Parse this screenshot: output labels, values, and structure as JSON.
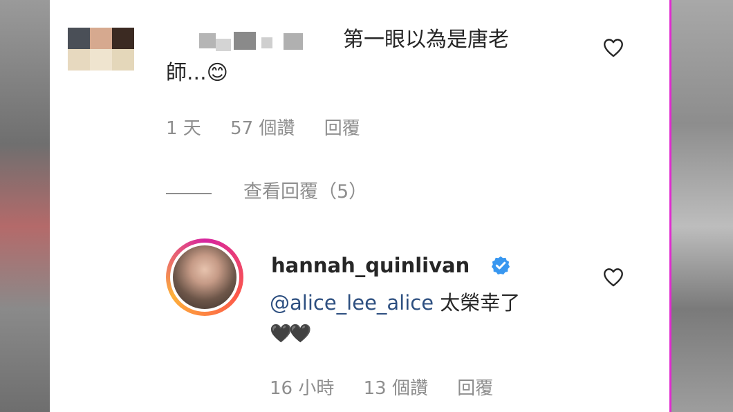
{
  "comment1": {
    "text_line1": "第一眼以為是唐老",
    "text_line2": "師...😊",
    "time": "1 天",
    "likes": "57 個讚",
    "reply": "回覆",
    "view_replies": "查看回覆（5）"
  },
  "comment2": {
    "username": "hannah_quinlivan",
    "mention": "@alice_lee_alice",
    "text": " 太榮幸了",
    "emoji": "🖤🖤",
    "time": "16 小時",
    "likes": "13 個讚",
    "reply": "回覆"
  },
  "colors": {
    "text": "#262626",
    "meta": "#8e8e8e",
    "verified": "#3897f0",
    "mention": "#2d4f80",
    "divider": "#e02ad0"
  },
  "icons": {
    "like": "heart-outline-icon",
    "verified": "verified-badge-icon"
  }
}
